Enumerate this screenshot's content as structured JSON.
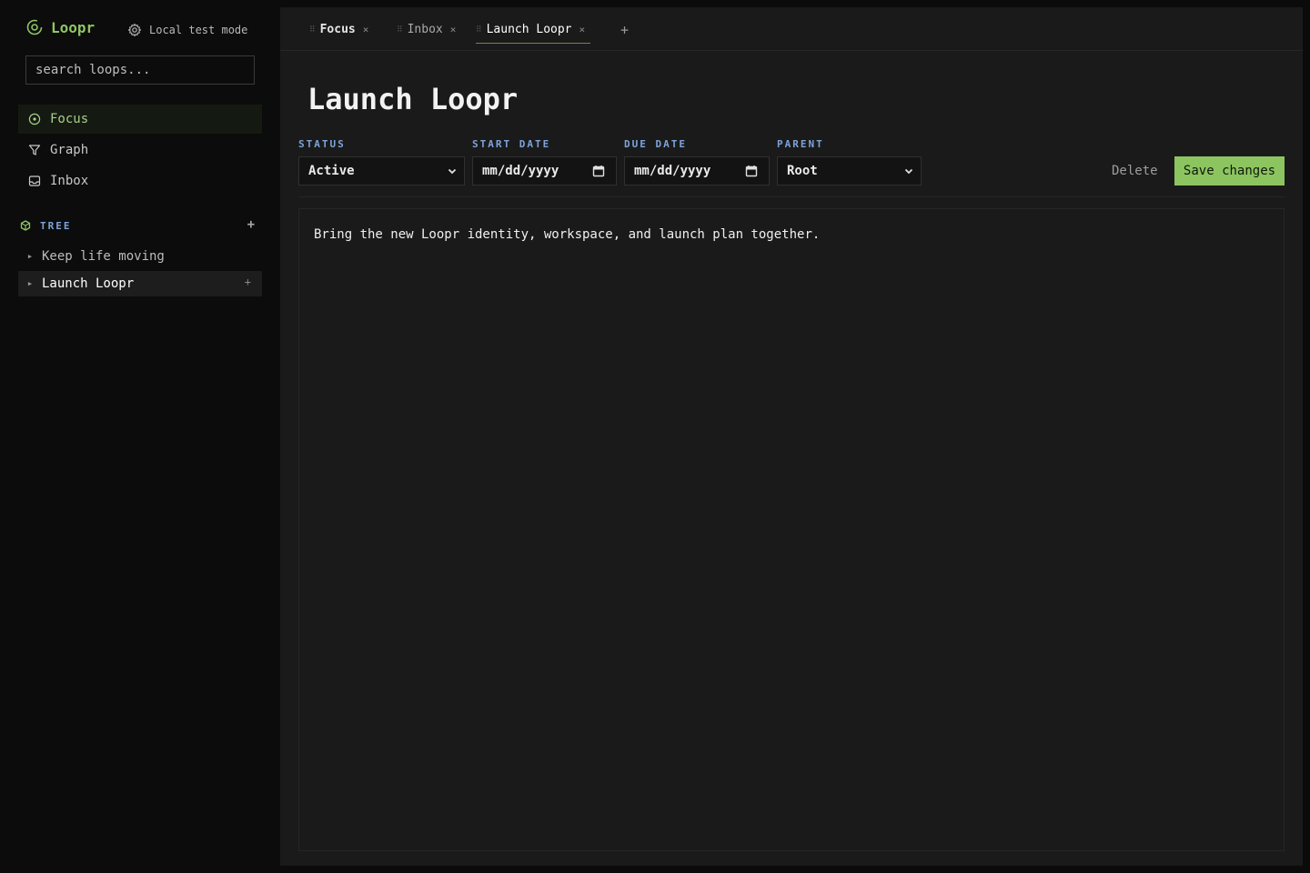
{
  "brand": {
    "name": "Loopr",
    "accent": "#8fc563"
  },
  "mode": {
    "label": "Local test mode",
    "icon": "gear-icon"
  },
  "search": {
    "placeholder": "search loops..."
  },
  "nav": [
    {
      "label": "Focus",
      "icon": "target-icon",
      "active": true
    },
    {
      "label": "Graph",
      "icon": "graph-icon",
      "active": false
    },
    {
      "label": "Inbox",
      "icon": "inbox-icon",
      "active": false
    }
  ],
  "tree": {
    "heading": "TREE",
    "add_label": "+",
    "items": [
      {
        "label": "Keep life moving",
        "selected": false
      },
      {
        "label": "Launch Loopr",
        "selected": true,
        "add_label": "+"
      }
    ]
  },
  "tabs": [
    {
      "label": "Focus",
      "close": "×"
    },
    {
      "label": "Inbox",
      "close": "×"
    },
    {
      "label": "Launch Loopr",
      "close": "×",
      "current": true
    }
  ],
  "tab_add": "+",
  "loop": {
    "title": "Launch Loopr",
    "status_label": "STATUS",
    "status_value": "Active",
    "start_label": "START DATE",
    "start_value": "mm/dd/yyyy",
    "due_label": "DUE DATE",
    "due_value": "mm/dd/yyyy",
    "parent_label": "PARENT",
    "parent_value": "Root",
    "delete_label": "Delete",
    "save_label": "Save changes",
    "description": "Bring the new Loopr identity, workspace, and launch plan together."
  },
  "colors": {
    "accent": "#8cc55f",
    "label_blue": "#7ea3d9",
    "main_bg": "#1a1a1a",
    "sidebar_bg": "#0c0c0c"
  }
}
